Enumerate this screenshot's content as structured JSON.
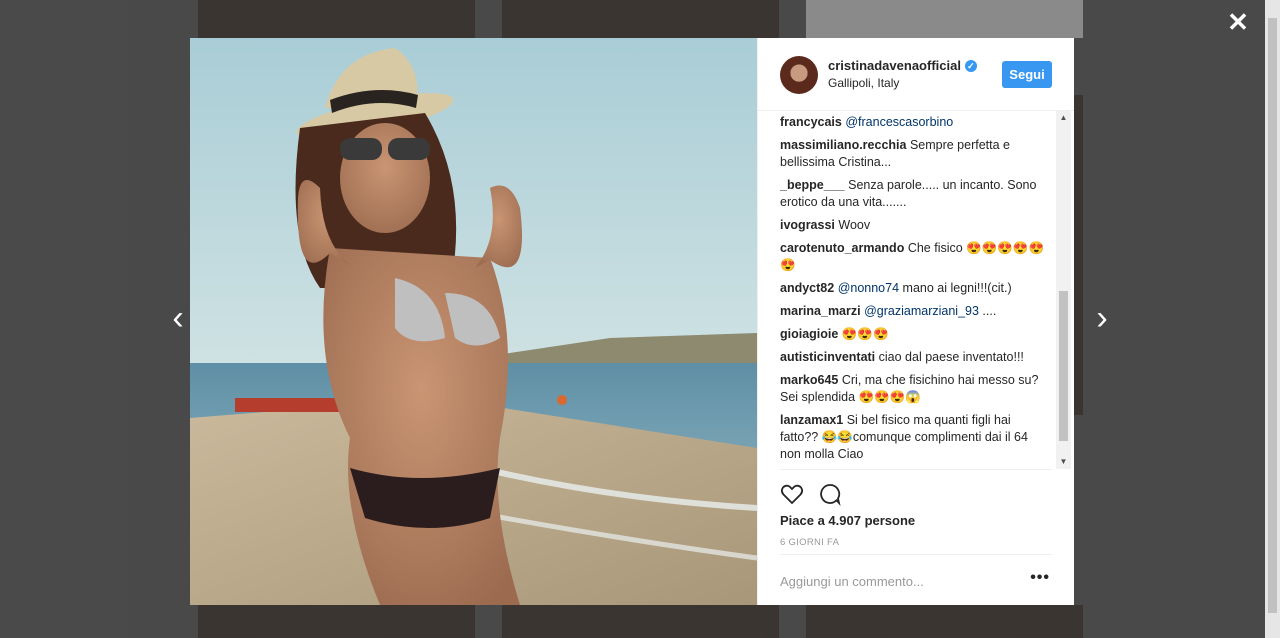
{
  "post": {
    "username": "cristinadavenaofficial",
    "location": "Gallipoli, Italy",
    "follow_label": "Segui",
    "likes_text": "Piace a 4.907 persone",
    "date_text": "6 GIORNI FA",
    "add_comment_placeholder": "Aggiungi un commento...",
    "more_label": "•••"
  },
  "controls": {
    "close_glyph": "✕",
    "prev_glyph": "‹",
    "next_glyph": "›"
  },
  "comments": [
    {
      "user": "francycais",
      "mention": "@francescasorbino",
      "text": ""
    },
    {
      "user": "massimiliano.recchia",
      "mention": "",
      "text": "Sempre perfetta e bellissima Cristina..."
    },
    {
      "user": "_beppe___",
      "mention": "",
      "text": "Senza parole..... un incanto. Sono erotico da una vita......."
    },
    {
      "user": "ivograssi",
      "mention": "",
      "text": "Woov"
    },
    {
      "user": "carotenuto_armando",
      "mention": "",
      "text": "Che fisico 😍😍😍😍😍😍"
    },
    {
      "user": "andyct82",
      "mention": "@nonno74",
      "text": "mano ai legni!!!(cit.)"
    },
    {
      "user": "marina_marzi",
      "mention": "@graziamarziani_93",
      "text": "...."
    },
    {
      "user": "gioiagioie",
      "mention": "",
      "text": "😍😍😍"
    },
    {
      "user": "autisticinventati",
      "mention": "",
      "text": "ciao dal paese inventato!!!"
    },
    {
      "user": "marko645",
      "mention": "",
      "text": "Cri, ma che fisichino hai messo su? Sei splendida 😍😍😍😱"
    },
    {
      "user": "lanzamax1",
      "mention": "",
      "text": "Si bel fisico ma quanti figli hai fatto?? 😂😂comunque complimenti dai il 64 non molla Ciao"
    }
  ]
}
